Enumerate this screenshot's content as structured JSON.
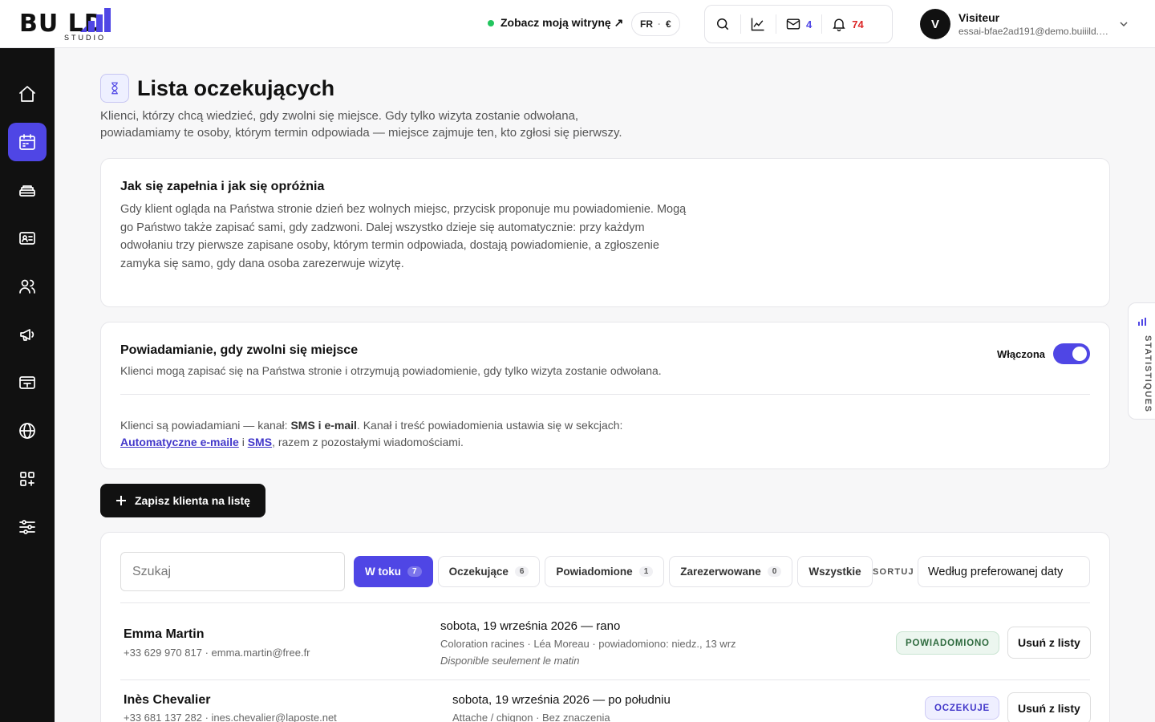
{
  "brand": {
    "logo_word": "BU   LD",
    "logo_sub": "STUDIO"
  },
  "header": {
    "site_link": "Zobacz moją witrynę ↗",
    "lang": "FR",
    "lang_sep": "·",
    "currency": "€",
    "messages_count": "4",
    "notifications_count": "74",
    "user": {
      "initial": "V",
      "name": "Visiteur",
      "email": "essai-bfae2ad191@demo.buiiild.c..."
    }
  },
  "sidebar": {
    "items": [
      {
        "icon": "home-icon"
      },
      {
        "icon": "calendar-icon",
        "active": true
      },
      {
        "icon": "services-icon"
      },
      {
        "icon": "contact-card-icon"
      },
      {
        "icon": "users-icon"
      },
      {
        "icon": "megaphone-icon"
      },
      {
        "icon": "cash-register-icon"
      },
      {
        "icon": "globe-icon"
      },
      {
        "icon": "apps-icon"
      },
      {
        "icon": "sliders-icon"
      }
    ]
  },
  "page": {
    "title": "Lista oczekujących",
    "description": "Klienci, którzy chcą wiedzieć, gdy zwolni się miejsce. Gdy tylko wizyta zostanie odwołana, powiadamiamy te osoby, którym termin odpowiada — miejsce zajmuje ten, kto zgłosi się pierwszy."
  },
  "how_card": {
    "title": "Jak się zapełnia i jak się opróżnia",
    "text": "Gdy klient ogląda na Państwa stronie dzień bez wolnych miejsc, przycisk proponuje mu powiadomienie. Mogą go Państwo także zapisać sami, gdy zadzwoni. Dalej wszystko dzieje się automatycznie: przy każdym odwołaniu trzy pierwsze zapisane osoby, którym termin odpowiada, dostają powiadomienie, a zgłoszenie zamyka się samo, gdy dana osoba zarezerwuje wizytę."
  },
  "notify_card": {
    "title": "Powiadamianie, gdy zwolni się miejsce",
    "subtitle": "Klienci mogą zapisać się na Państwa stronie i otrzymują powiadomienie, gdy tylko wizyta zostanie odwołana.",
    "toggle_label": "Włączona",
    "toggle_on": true,
    "info_prefix": "Klienci są powiadamiani — kanał: ",
    "info_channel": "SMS i e-mail",
    "info_middle": ". Kanał i treść powiadomienia ustawia się w sekcjach:",
    "link_emails": "Automatyczne e-maile",
    "info_and": " i ",
    "link_sms": "SMS",
    "info_suffix": ", razem z pozostałymi wiadomościami."
  },
  "add_button": "Zapisz klienta na listę",
  "list": {
    "search_placeholder": "Szukaj",
    "filters": [
      {
        "label": "W toku",
        "count": "7",
        "active": true
      },
      {
        "label": "Oczekujące",
        "count": "6"
      },
      {
        "label": "Powiadomione",
        "count": "1"
      },
      {
        "label": "Zarezerwowane",
        "count": "0"
      },
      {
        "label": "Wszystkie",
        "count": ""
      }
    ],
    "sort_label": "SORTUJ",
    "sort_value": "Według preferowanej daty",
    "rows": [
      {
        "name": "Emma Martin",
        "contact": "+33 629 970 817 · emma.martin@free.fr",
        "date": "sobota, 19 września 2026 — rano",
        "meta": "Coloration racines · Léa Moreau · powiadomiono: niedz., 13 wrz",
        "note": "Disponible seulement le matin",
        "status": "POWIADOMIONO",
        "remove": "Usuń z listy"
      },
      {
        "name": "Inès Chevalier",
        "contact": "+33 681 137 282 · ines.chevalier@laposte.net",
        "date": "sobota, 19 września 2026 — po południu",
        "meta": "Attache / chignon · Bez znaczenia",
        "note": "",
        "status": "OCZEKUJE",
        "remove": "Usuń z listy"
      }
    ]
  },
  "side_tab": {
    "label": "STATISTIQUES"
  },
  "colors": {
    "accent": "#4f46e5",
    "sidebar": "#111111",
    "status_green": "#2f6b3f",
    "live_dot": "#22c55e",
    "notification_red": "#dc2626"
  }
}
